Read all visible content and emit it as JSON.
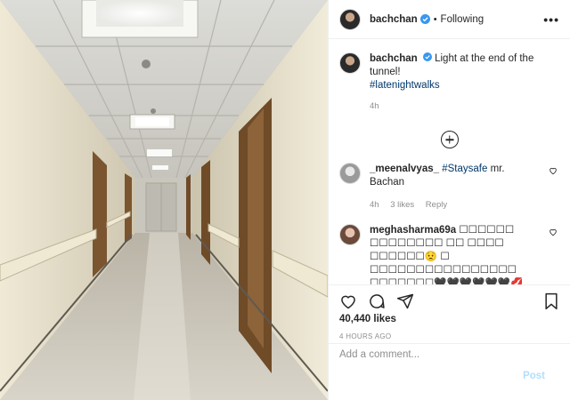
{
  "post": {
    "username": "bachchan",
    "follow_state": "Following",
    "separator": "•",
    "more": "•••"
  },
  "caption": {
    "username": "bachchan",
    "text": "Light at the end of the tunnel!",
    "hashtag": "#latenightwalks",
    "time": "4h"
  },
  "comments": [
    {
      "username": "_meenalvyas_",
      "hashtag": "#Staysafe",
      "text": "mr. Bachan",
      "time": "4h",
      "likes": "3 likes",
      "reply": "Reply"
    },
    {
      "username": "meghasharma69a",
      "text": "☐☐☐☐☐☐ ☐☐☐☐☐☐☐☐ ☐☐ ☐☐☐☐ ☐☐☐☐☐☐😟 ☐ ☐☐☐☐☐☐☐☐☐☐☐☐☐☐☐☐ ☐☐☐☐☐☐☐🖤🖤🖤🖤🖤🖤💋💋💋💋💋"
    }
  ],
  "stats": {
    "likes": "40,440 likes",
    "timestamp": "4 HOURS AGO"
  },
  "add_comment": {
    "placeholder": "Add a comment...",
    "post_label": "Post"
  },
  "colors": {
    "link": "#00376b",
    "verified": "#3897f0",
    "post_disabled": "#b2dffc"
  }
}
